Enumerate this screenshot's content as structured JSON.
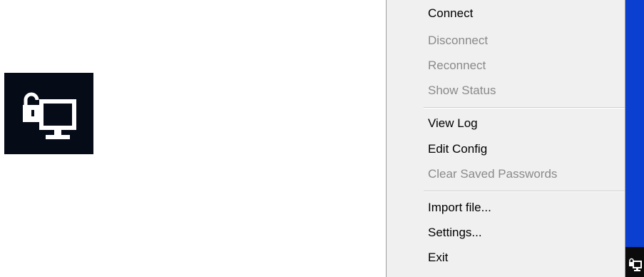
{
  "tray_icon": {
    "icon": "locked-monitor-icon",
    "background": "#050b17"
  },
  "menu": {
    "items": [
      {
        "label": "Connect",
        "enabled": true
      },
      {
        "label": "Disconnect",
        "enabled": false
      },
      {
        "label": "Reconnect",
        "enabled": false
      },
      {
        "label": "Show Status",
        "enabled": false
      },
      {
        "label": "View Log",
        "enabled": true
      },
      {
        "label": "Edit Config",
        "enabled": true
      },
      {
        "label": "Clear Saved Passwords",
        "enabled": false
      },
      {
        "label": "Import file...",
        "enabled": true
      },
      {
        "label": "Settings...",
        "enabled": true
      },
      {
        "label": "Exit",
        "enabled": true
      }
    ]
  },
  "colors": {
    "desktop": "#0a3fd0",
    "taskbar": "#0b0b0b",
    "menu_bg": "#f0f0f0",
    "disabled_text": "#8a8a8a"
  }
}
